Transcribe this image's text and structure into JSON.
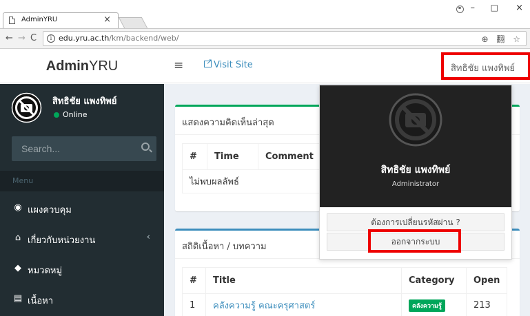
{
  "browser": {
    "tab_title": "AdminYRU",
    "tab_close": "×",
    "url_host": "edu.yru.ac.th",
    "url_path": "/km/backend/web/",
    "info_icon": "i",
    "window_controls": {
      "minimize": "–",
      "maximize": "□",
      "close": "×"
    },
    "nav": {
      "back": "←",
      "forward": "→",
      "reload": "C"
    },
    "omni_icons": {
      "zoom": "⊕",
      "translate": "翻",
      "star": "☆"
    }
  },
  "header": {
    "logo_bold": "Admin",
    "logo_rest": "YRU",
    "menu_toggle": "≡",
    "visit_site": "Visit Site",
    "user_name": "สิทธิชัย แพงทิพย์"
  },
  "sidebar": {
    "user_name": "สิทธิชัย แพงทิพย์",
    "status": "Online",
    "status_color": "#00a65a",
    "search_placeholder": "Search...",
    "menu_label": "Menu",
    "items": [
      {
        "label": "แผงควบคุม",
        "icon": "dashboard-icon",
        "glyph": "◉"
      },
      {
        "label": "เกี่ยวกับหน่วยงาน",
        "icon": "institution-icon",
        "glyph": "⌂",
        "chevron": "‹"
      },
      {
        "label": "หมวดหมู่",
        "icon": "tags-icon",
        "glyph": "◆"
      },
      {
        "label": "เนื้อหา",
        "icon": "newspaper-icon",
        "glyph": "▤"
      }
    ]
  },
  "comments_box": {
    "title": "แสดงความคิดเห็นล่าสุด",
    "columns": [
      "#",
      "Time",
      "Comment"
    ],
    "empty_text": "ไม่พบผลลัพธ์"
  },
  "content_box": {
    "title": "สถิติเนื้อหา / บทความ",
    "columns": [
      "#",
      "Title",
      "Category",
      "Open"
    ],
    "rows": [
      {
        "num": "1",
        "title": "คลังความรู้ คณะครุศาสตร์",
        "category": "คลังความรู้",
        "open": "213"
      }
    ]
  },
  "dropdown": {
    "name": "สิทธิชัย แพงทิพย์",
    "role": "Administrator",
    "change_password": "ต้องการเปลี่ยนรหัสผ่าน ?",
    "logout": "ออกจากระบบ"
  },
  "colors": {
    "sidebar_bg": "#222d32",
    "accent_blue": "#3c8dbc",
    "accent_green": "#00a65a",
    "highlight_red": "#ee0000"
  }
}
